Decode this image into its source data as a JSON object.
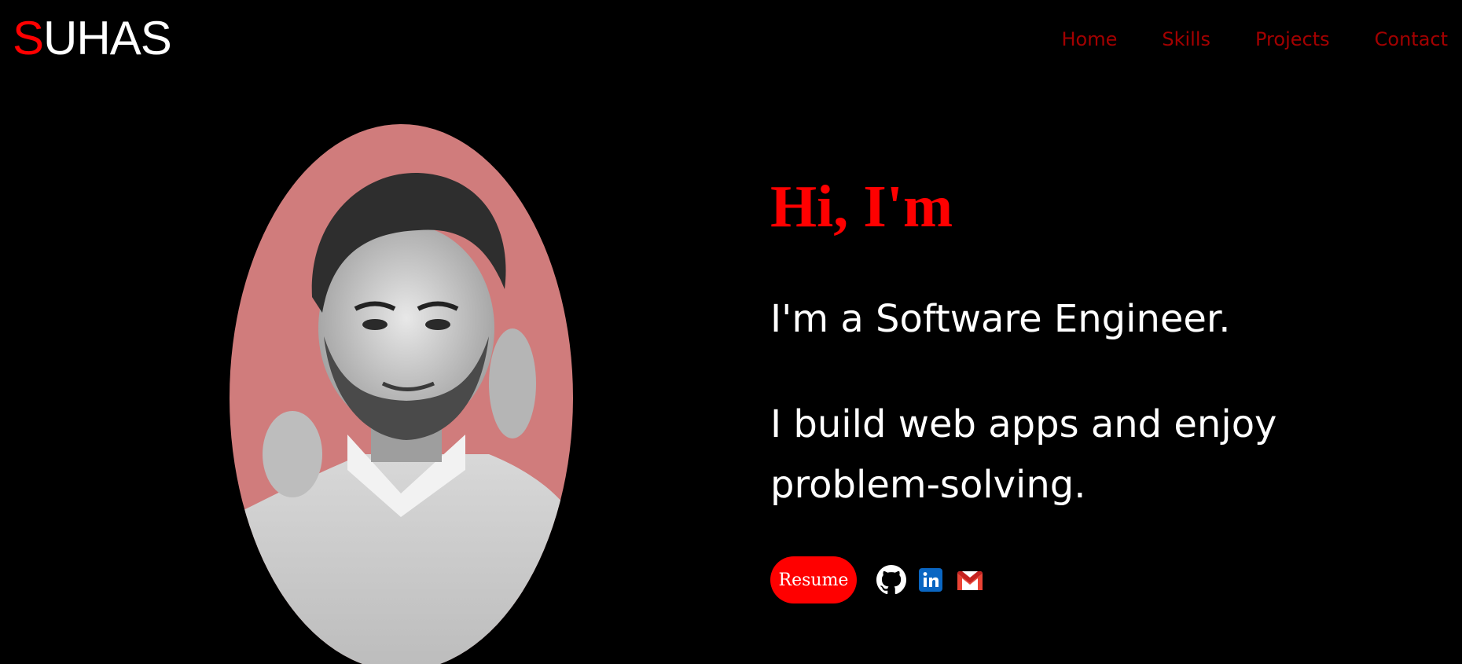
{
  "header": {
    "logo_first": "S",
    "logo_rest": "UHAS",
    "nav": [
      "Home",
      "Skills",
      "Projects",
      "Contact"
    ]
  },
  "hero": {
    "greeting": "Hi, I'm",
    "role": "I'm a Software Engineer.",
    "about": "I build web apps and enjoy problem-solving.",
    "resume_label": "Resume"
  },
  "social": {
    "icons": [
      "github-icon",
      "linkedin-icon",
      "gmail-icon"
    ]
  },
  "colors": {
    "accent": "#ff0000",
    "nav": "#a30000",
    "background": "#000000",
    "portrait_bg": "#d07c7c"
  }
}
